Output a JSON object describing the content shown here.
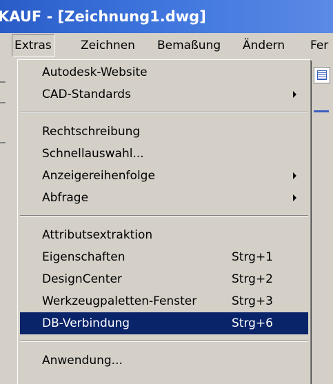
{
  "window": {
    "title": "KAUF - [Zeichnung1.dwg]"
  },
  "menubar": {
    "items": [
      "Extras",
      "Zeichnen",
      "Bemaßung",
      "Ändern",
      "Fer"
    ]
  },
  "menu": {
    "groups": [
      [
        {
          "label": "Autodesk-Website",
          "shortcut": "",
          "submenu": false
        },
        {
          "label": "CAD-Standards",
          "shortcut": "",
          "submenu": true
        }
      ],
      [
        {
          "label": "Rechtschreibung",
          "shortcut": "",
          "submenu": false
        },
        {
          "label": "Schnellauswahl...",
          "shortcut": "",
          "submenu": false
        },
        {
          "label": "Anzeigereihenfolge",
          "shortcut": "",
          "submenu": true
        },
        {
          "label": "Abfrage",
          "shortcut": "",
          "submenu": true
        }
      ],
      [
        {
          "label": "Attributsextraktion",
          "shortcut": "",
          "submenu": false
        },
        {
          "label": "Eigenschaften",
          "shortcut": "Strg+1",
          "submenu": false
        },
        {
          "label": "DesignCenter",
          "shortcut": "Strg+2",
          "submenu": false
        },
        {
          "label": "Werkzeugpaletten-Fenster",
          "shortcut": "Strg+3",
          "submenu": false
        },
        {
          "label": "DB-Verbindung",
          "shortcut": "Strg+6",
          "submenu": false,
          "highlighted": true
        }
      ],
      [
        {
          "label": "Anwendung...",
          "shortcut": "",
          "submenu": false
        }
      ]
    ]
  },
  "colors": {
    "highlight": "#0a246a",
    "title_bar": "#2a5cc8",
    "menu_bg": "#d4d0c8"
  }
}
